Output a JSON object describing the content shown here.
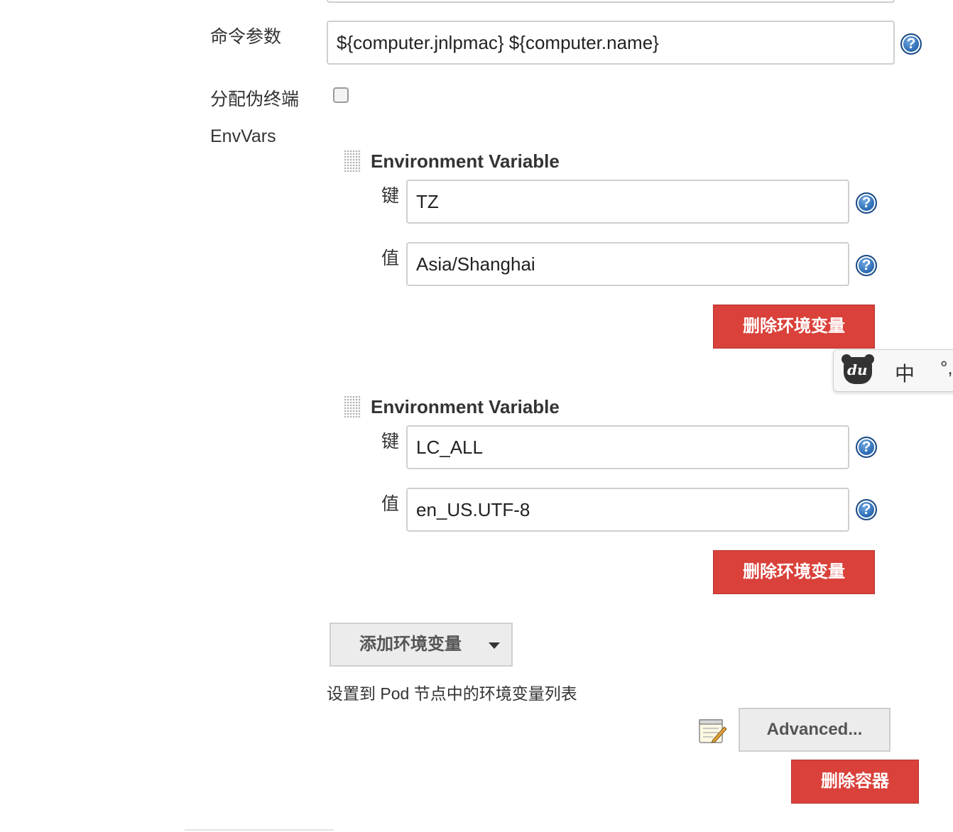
{
  "command_args": {
    "label": "命令参数",
    "value": "${computer.jnlpmac} ${computer.name}"
  },
  "alloc_tty": {
    "label": "分配伪终端",
    "checked": false
  },
  "envvars": {
    "label": "EnvVars",
    "items": [
      {
        "title": "Environment Variable",
        "key_label": "键",
        "key_value": "TZ",
        "value_label": "值",
        "value_value": "Asia/Shanghai",
        "delete_label": "删除环境变量"
      },
      {
        "title": "Environment Variable",
        "key_label": "键",
        "key_value": "LC_ALL",
        "value_label": "值",
        "value_value": "en_US.UTF-8",
        "delete_label": "删除环境变量"
      }
    ],
    "add_label": "添加环境变量",
    "description": "设置到 Pod 节点中的环境变量列表"
  },
  "advanced_label": "Advanced...",
  "delete_container_label": "删除容器",
  "help_glyph": "?",
  "ime": {
    "logo": "du",
    "mode": "中",
    "punct": "°,"
  },
  "colors": {
    "danger": "#d9413a",
    "help_blue": "#2b6cb5",
    "button_gray": "#ececec"
  }
}
